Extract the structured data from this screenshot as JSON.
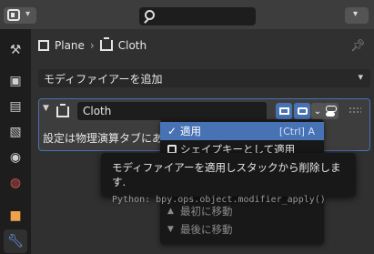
{
  "header": {
    "search_placeholder": ""
  },
  "breadcrumb": {
    "object": "Plane",
    "modifier": "Cloth"
  },
  "add_modifier": {
    "label": "モディファイアーを追加"
  },
  "modifier_panel": {
    "name": "Cloth",
    "info_text": "設定は物理演算タブにあります"
  },
  "dropdown": {
    "items": [
      {
        "label": "適用",
        "shortcut": "[Ctrl] A",
        "highlighted": true
      },
      {
        "label": "シェイプキーとして適用"
      },
      {
        "label": "最初に移動"
      },
      {
        "label": "最後に移動"
      }
    ]
  },
  "tooltip": {
    "description": "モディファイアーを適用しスタックから削除します.",
    "python": "Python: bpy.ops.object.modifier_apply()"
  },
  "colors": {
    "accent": "#4772b3",
    "background": "#303030",
    "header": "#3d3d3d",
    "tabs": "#1d1d1d"
  },
  "tab_icons": [
    "tool-icon",
    "render-icon",
    "output-icon",
    "view-layer-icon",
    "scene-icon",
    "world-icon",
    "object-icon",
    "modifier-icon"
  ]
}
